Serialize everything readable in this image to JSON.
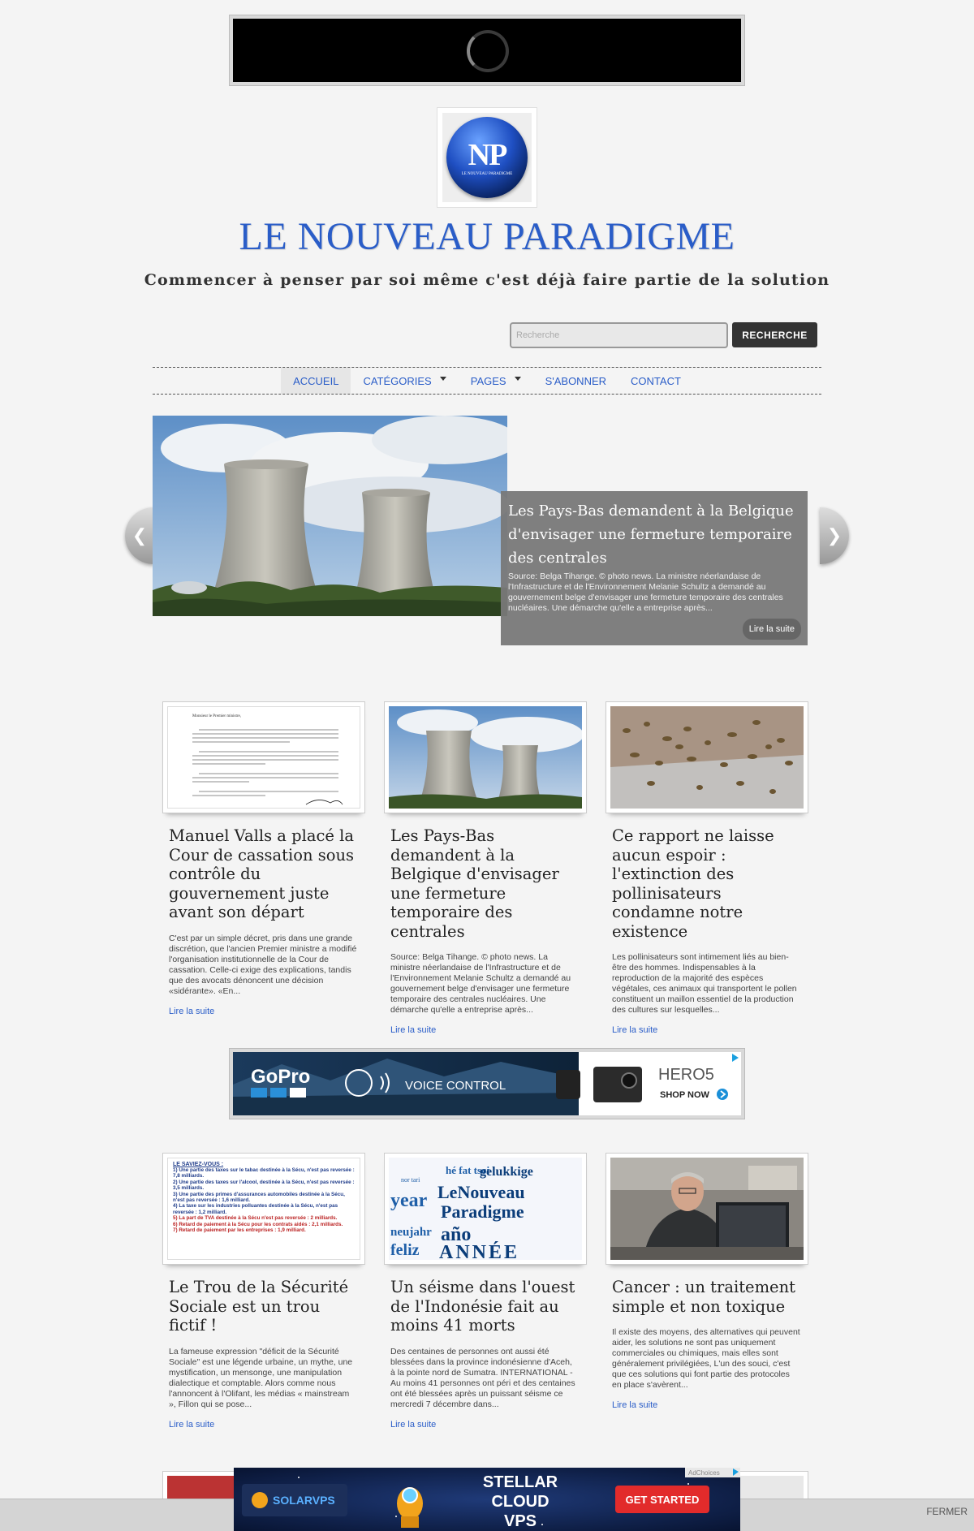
{
  "site": {
    "title": "LE NOUVEAU PARADIGME",
    "tagline": "Commencer à penser par soi même c'est déjà faire partie de la solution",
    "logo_letters": "NP",
    "logo_small_text": "LE NOUVEAU PARADIGME"
  },
  "search": {
    "placeholder": "Recherche",
    "button_label": "RECHERCHE"
  },
  "nav": {
    "items": [
      {
        "label": "ACCUEIL"
      },
      {
        "label": "CATÉGORIES"
      },
      {
        "label": "PAGES"
      },
      {
        "label": "S'ABONNER"
      },
      {
        "label": "CONTACT"
      }
    ]
  },
  "slider": {
    "title": "Les Pays-Bas demandent à la Belgique d'envisager une fermeture temporaire des centrales",
    "excerpt": "Source: Belga Tihange. © photo news. La ministre néerlandaise de l'Infrastructure et de l'Environnement Melanie Schultz a demandé au gouvernement belge d'envisager une fermeture temporaire des centrales nucléaires. Une démarche qu'elle a entreprise après...",
    "more": "Lire la suite"
  },
  "articles": [
    {
      "title": "Manuel Valls a placé la Cour de cassation sous contrôle du gouvernement juste avant son départ",
      "excerpt": "C'est par un simple décret, pris dans une grande discrétion, que l'ancien Premier ministre a modifié l'organisation institutionnelle de la Cour de cassation. Celle-ci exige des explications, tandis que des avocats dénoncent une décision «sidérante». «En...",
      "more": "Lire la suite"
    },
    {
      "title": "Les Pays-Bas demandent à la Belgique d'envisager une fermeture temporaire des centrales",
      "excerpt": "Source: Belga Tihange. © photo news. La ministre néerlandaise de l'Infrastructure et de l'Environnement Melanie Schultz a demandé au gouvernement belge d'envisager une fermeture temporaire des centrales nucléaires. Une démarche qu'elle a entreprise après...",
      "more": "Lire la suite"
    },
    {
      "title": "Ce rapport ne laisse aucun espoir : l'extinction des pollinisateurs condamne notre existence",
      "excerpt": "Les pollinisateurs sont intimement liés au bien-être des hommes. Indispensables à la reproduction de la majorité des espèces végétales, ces animaux qui transportent le pollen constituent un maillon essentiel de la production des cultures sur lesquelles...",
      "more": "Lire la suite"
    },
    {
      "title": "Le Trou de la Sécurité Sociale est un trou fictif !",
      "excerpt": "La fameuse expression \"déficit de la Sécurité Sociale\" est une légende urbaine, un mythe, une mystification, un mensonge, une manipulation dialectique et comptable. Alors comme nous l'annoncent à l'Olifant, les médias « mainstream », Fillon qui se pose...",
      "more": "Lire la suite"
    },
    {
      "title": "Un séisme dans l'ouest de l'Indonésie fait au moins 41 morts",
      "excerpt": "Des centaines de personnes ont aussi été blessées dans la province indonésienne d'Aceh, à la pointe nord de Sumatra. INTERNATIONAL - Au moins 41 personnes ont péri et des centaines ont été blessées après un puissant séisme ce mercredi 7 décembre dans...",
      "more": "Lire la suite"
    },
    {
      "title": "Cancer : un traitement simple et non toxique",
      "excerpt": "Il existe des moyens, des alternatives qui peuvent aider, les solutions ne sont pas uniquement commerciales ou chimiques, mais elles sont généralement privilégiées, L'un des souci, c'est que ces solutions qui font partie des protocoles en place s'avèrent...",
      "more": "Lire la suite"
    }
  ],
  "thumbs": {
    "doc_heading": "Monsieur le Premier ministre,",
    "secu_heading": "LE SAVIEZ-VOUS :",
    "secu_lines": [
      "1) Une partie des taxes sur le tabac destinée à la Sécu, n'est pas reversée : 7,8 milliards.",
      "2) Une partie des taxes sur l'alcool, destinée à la Sécu, n'est pas reversée : 3,5 milliards.",
      "3) Une partie des primes d'assurances automobiles destinée à la Sécu, n'est pas reversée : 1,6 milliard.",
      "4) La taxe sur les industries polluantes destinée à la Sécu, n'est pas reversée : 1,2 milliard.",
      "5) La part de TVA destinée à la Sécu n'est pas reversée : 2 milliards.",
      "6) Retard de paiement à la Sécu pour les contrats aidés : 2,1 milliards.",
      "7) Retard de paiement par les entreprises : 1,9 milliard."
    ],
    "cloud_words": [
      "gelukkige",
      "LeNouveau",
      "Paradigme",
      "year",
      "año",
      "ANNÉE",
      "feliz",
      "neujahr",
      "hé fat tsoi",
      "nor tari"
    ]
  },
  "ads": {
    "gopro": {
      "brand": "GoPro",
      "tagline": "VOICE CONTROL",
      "product": "HERO5",
      "cta": "SHOP NOW"
    },
    "solar": {
      "brand": "SOLARVPS",
      "headline": [
        "STELLAR",
        "CLOUD",
        "VPS"
      ],
      "cta": "GET STARTED",
      "adchoices": "AdChoices"
    }
  },
  "footer": {
    "close_label": "FERMER"
  },
  "colors": {
    "accent": "#2a5dc8",
    "caption_bg": "#787878",
    "button_dark": "#333333"
  }
}
